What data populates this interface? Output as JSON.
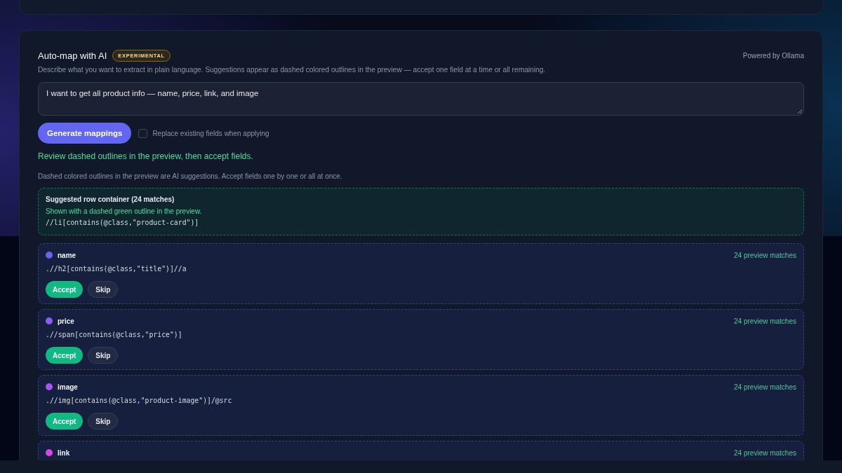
{
  "auto_map": {
    "title": "Auto-map with AI",
    "badge": "EXPERIMENTAL",
    "powered_by": "Powered by Ollama",
    "description": "Describe what you want to extract in plain language. Suggestions appear as dashed colored outlines in the preview — accept one field at a time or all remaining.",
    "prompt": {
      "value": "I want to get all product info — name, price, link, and image"
    },
    "generate_button": "Generate mappings",
    "replace_option": {
      "label": "Replace existing fields when applying",
      "checked": false
    },
    "status_message": "Review dashed outlines in the preview, then accept fields.",
    "hint": "Dashed colored outlines in the preview are AI suggestions. Accept fields one by one or all at once.",
    "row_container": {
      "title": "Suggested row container (24 matches)",
      "note": "Shown with a dashed green outline in the preview.",
      "xpath": "//li[contains(@class,\"product-card\")]"
    },
    "fields": [
      {
        "name": "name",
        "color": "#6366f1",
        "matches": "24 preview matches",
        "xpath": ".//h2[contains(@class,\"title\")]//a",
        "actions": [
          {
            "label": "Accept",
            "kind": "primary"
          },
          {
            "label": "Skip",
            "kind": "secondary"
          }
        ]
      },
      {
        "name": "price",
        "color": "#8b5cf6",
        "matches": "24 preview matches",
        "xpath": ".//span[contains(@class,\"price\")]",
        "actions": [
          {
            "label": "Accept",
            "kind": "primary"
          },
          {
            "label": "Skip",
            "kind": "secondary"
          }
        ]
      },
      {
        "name": "image",
        "color": "#a855f7",
        "matches": "24 preview matches",
        "xpath": ".//img[contains(@class,\"product-image\")]/@src",
        "actions": [
          {
            "label": "Accept",
            "kind": "primary"
          },
          {
            "label": "Skip",
            "kind": "secondary"
          }
        ]
      },
      {
        "name": "link",
        "color": "#d946ef",
        "matches": "24 preview matches"
      }
    ]
  }
}
